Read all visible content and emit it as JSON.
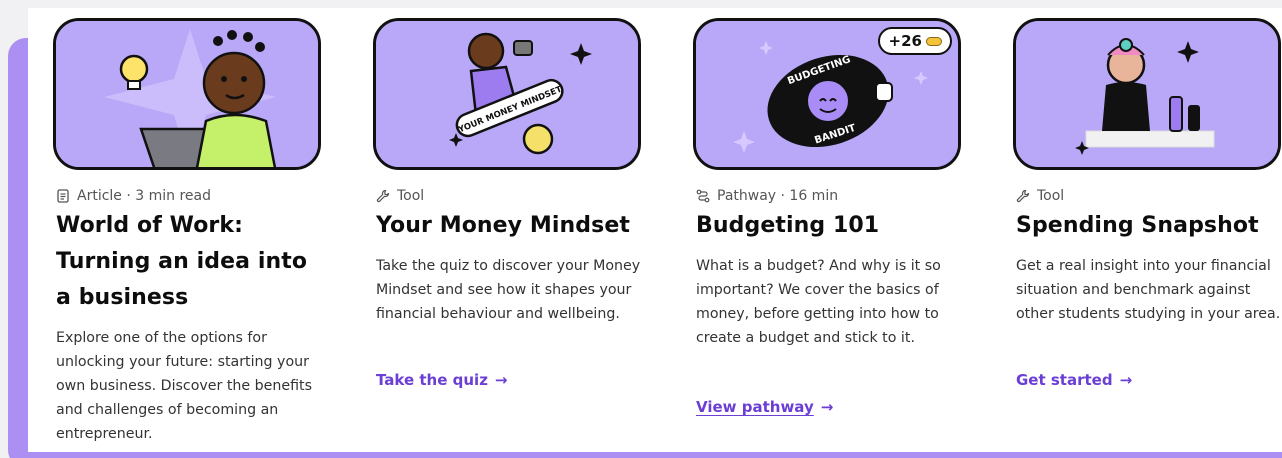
{
  "colors": {
    "accent": "#6b3fd4",
    "panel": "#ab8ff2",
    "thumb": "#b9a8f7"
  },
  "cards": [
    {
      "type_icon": "document-icon",
      "meta": "Article · 3 min read",
      "title": "World of Work: Turning an idea into a business",
      "description": "Explore one of the options for unlocking your future: starting your own business. Discover the benefits and challenges of becoming an entrepreneur.",
      "cta": ""
    },
    {
      "type_icon": "wrench-icon",
      "meta": "Tool",
      "title": "Your Money Mindset",
      "description": "Take the quiz to discover your Money Mindset and see how it shapes your financial behaviour and wellbeing.",
      "cta": "Take the quiz",
      "image_text": "YOUR MONEY MINDSET"
    },
    {
      "type_icon": "pathway-icon",
      "meta": "Pathway · 16 min",
      "title": "Budgeting 101",
      "description": "What is a budget? And why is it so important? We cover the basics of money, before getting into how to create a budget and stick to it.",
      "cta": "View pathway",
      "badge": "+26",
      "image_text_top": "BUDGETING",
      "image_text_bottom": "BANDIT"
    },
    {
      "type_icon": "wrench-icon",
      "meta": "Tool",
      "title": "Spending Snapshot",
      "description": "Get a real insight into your financial situation and benchmark against other students studying in your area.",
      "cta": "Get started"
    }
  ]
}
